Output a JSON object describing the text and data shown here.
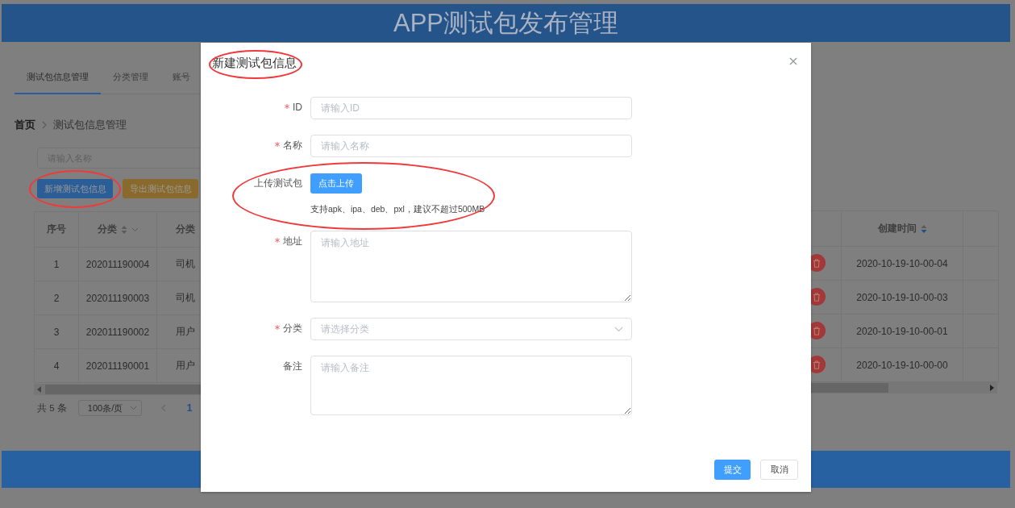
{
  "header": {
    "title": "APP测试包发布管理"
  },
  "tabs": [
    {
      "label": "测试包信息管理",
      "selected": true
    },
    {
      "label": "分类管理",
      "selected": false
    },
    {
      "label": "账号",
      "selected": false
    }
  ],
  "breadcrumb": [
    "首页",
    "测试包信息管理"
  ],
  "search": {
    "placeholder": "请输入名称"
  },
  "actions": [
    {
      "label": "新增测试包信息",
      "kind": "primary",
      "circled": true
    },
    {
      "label": "导出测试包信息",
      "kind": "warning",
      "circled": false
    }
  ],
  "table_left": {
    "columns": [
      {
        "label": "序号"
      },
      {
        "label": "分类",
        "sortable": true,
        "sorted_descending": false,
        "filter": true
      },
      {
        "label": "分类"
      }
    ],
    "rows": [
      [
        "1",
        "202011190004",
        "司机"
      ],
      [
        "2",
        "202011190003",
        "司机"
      ],
      [
        "3",
        "202011190002",
        "用户"
      ],
      [
        "4",
        "202011190001",
        "用户"
      ]
    ]
  },
  "table_right": {
    "columns": [
      {
        "label": "创建时间",
        "sortable": true,
        "sorted_descending": true
      }
    ],
    "rows": [
      {
        "delete": true,
        "time": "2020-10-19-10-00-04"
      },
      {
        "delete": true,
        "time": "2020-10-19-10-00-03"
      },
      {
        "delete": true,
        "time": "2020-10-19-10-00-01"
      },
      {
        "delete": true,
        "time": "2020-10-19-10-00-00"
      }
    ]
  },
  "pagination": {
    "total": "共 5 条",
    "page_size": "100条/页",
    "page": "1"
  },
  "dialog": {
    "title": "新建测试包信息",
    "title_circled": true,
    "fields": [
      {
        "kind": "input",
        "label": "ID",
        "required": true,
        "placeholder": "请输入ID"
      },
      {
        "kind": "input",
        "label": "名称",
        "required": true,
        "placeholder": "请输入名称"
      },
      {
        "kind": "upload",
        "label": "上传测试包",
        "required": false,
        "button": "点击上传",
        "hint": "支持apk、ipa、deb、pxl，建议不超过500MB",
        "circled": true
      },
      {
        "kind": "textarea",
        "label": "地址",
        "required": true,
        "placeholder": "请输入地址"
      },
      {
        "kind": "select",
        "label": "分类",
        "required": true,
        "placeholder": "请选择分类"
      },
      {
        "kind": "textarea",
        "label": "备注",
        "required": false,
        "placeholder": "请输入备注"
      }
    ],
    "buttons": [
      {
        "label": "提交",
        "kind": "primary"
      },
      {
        "label": "取消",
        "kind": "default"
      }
    ]
  }
}
